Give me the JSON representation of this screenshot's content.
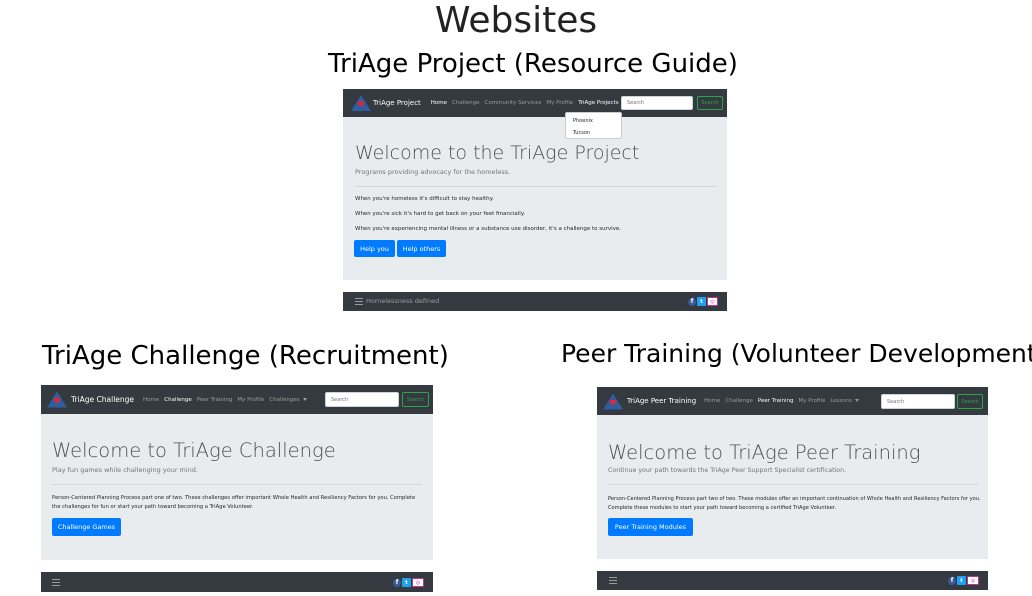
{
  "page": {
    "title": "Websites"
  },
  "colors": {
    "navbar": "#343a40",
    "jumbotron": "#e9ecef",
    "primary": "#007bff",
    "success": "#28a745",
    "logo_triangle": "#2f5d9e",
    "logo_heart": "#e0263c"
  },
  "sites": {
    "project": {
      "section_title": "TriAge Project (Resource Guide)",
      "brand": "TriAge Project",
      "nav": [
        "Home",
        "Challenge",
        "Community Services",
        "My Profile",
        "TriAge Projects"
      ],
      "active_nav": "Home",
      "search_placeholder": "Search",
      "search_button": "Search",
      "dropdown_items": [
        "Phoenix",
        "Tucson"
      ],
      "heading": "Welcome to the TriAge Project",
      "lead": "Programs providing advocacy for the homeless.",
      "paragraphs": [
        "When you're homeless it's difficult to stay healthy.",
        "When you're sick it's hard to get back on your feet financially.",
        "When you're experiencing mental illness or a substance use disorder, it's a challenge to survive."
      ],
      "buttons": [
        "Help you",
        "Help others"
      ],
      "footer_text": "Homelessness defined",
      "social_icons": [
        "facebook-icon",
        "twitter-icon",
        "instagram-icon"
      ]
    },
    "challenge": {
      "section_title": "TriAge Challenge (Recruitment)",
      "brand": "TriAge Challenge",
      "nav": [
        "Home",
        "Challenge",
        "Peer Training",
        "My Profile",
        "Challenges"
      ],
      "active_nav": "Challenge",
      "search_placeholder": "Search",
      "search_button": "Search",
      "heading": "Welcome to TriAge Challenge",
      "lead": "Play fun games while challenging your mind.",
      "paragraphs": [
        "Person-Centered Planning Process part one of two. These challenges offer important Whole Health and Resiliency Factors for you. Complete",
        "the challenges for fun or start your path toward becoming a TriAge Volunteer."
      ],
      "buttons": [
        "Challenge Games"
      ],
      "social_icons": [
        "facebook-icon",
        "twitter-icon",
        "instagram-icon"
      ]
    },
    "peer": {
      "section_title": "Peer Training (Volunteer Development)",
      "brand": "TriAge Peer Training",
      "nav": [
        "Home",
        "Challenge",
        "Peer Training",
        "My Profile",
        "Lessons"
      ],
      "active_nav": "Peer Training",
      "search_placeholder": "Search",
      "search_button": "Search",
      "heading": "Welcome to TriAge Peer Training",
      "lead": "Continue your path towards the TriAge Peer Support Specialist certification.",
      "paragraphs": [
        "Person-Centered Planning Process part two of two. These modules offer an important continuation of Whole Health and Resiliency Factors for you.",
        "Complete these modules to start your path toward becoming a certified TriAge Volunteer."
      ],
      "buttons": [
        "Peer Training Modules"
      ],
      "social_icons": [
        "facebook-icon",
        "twitter-icon",
        "instagram-icon"
      ]
    }
  }
}
